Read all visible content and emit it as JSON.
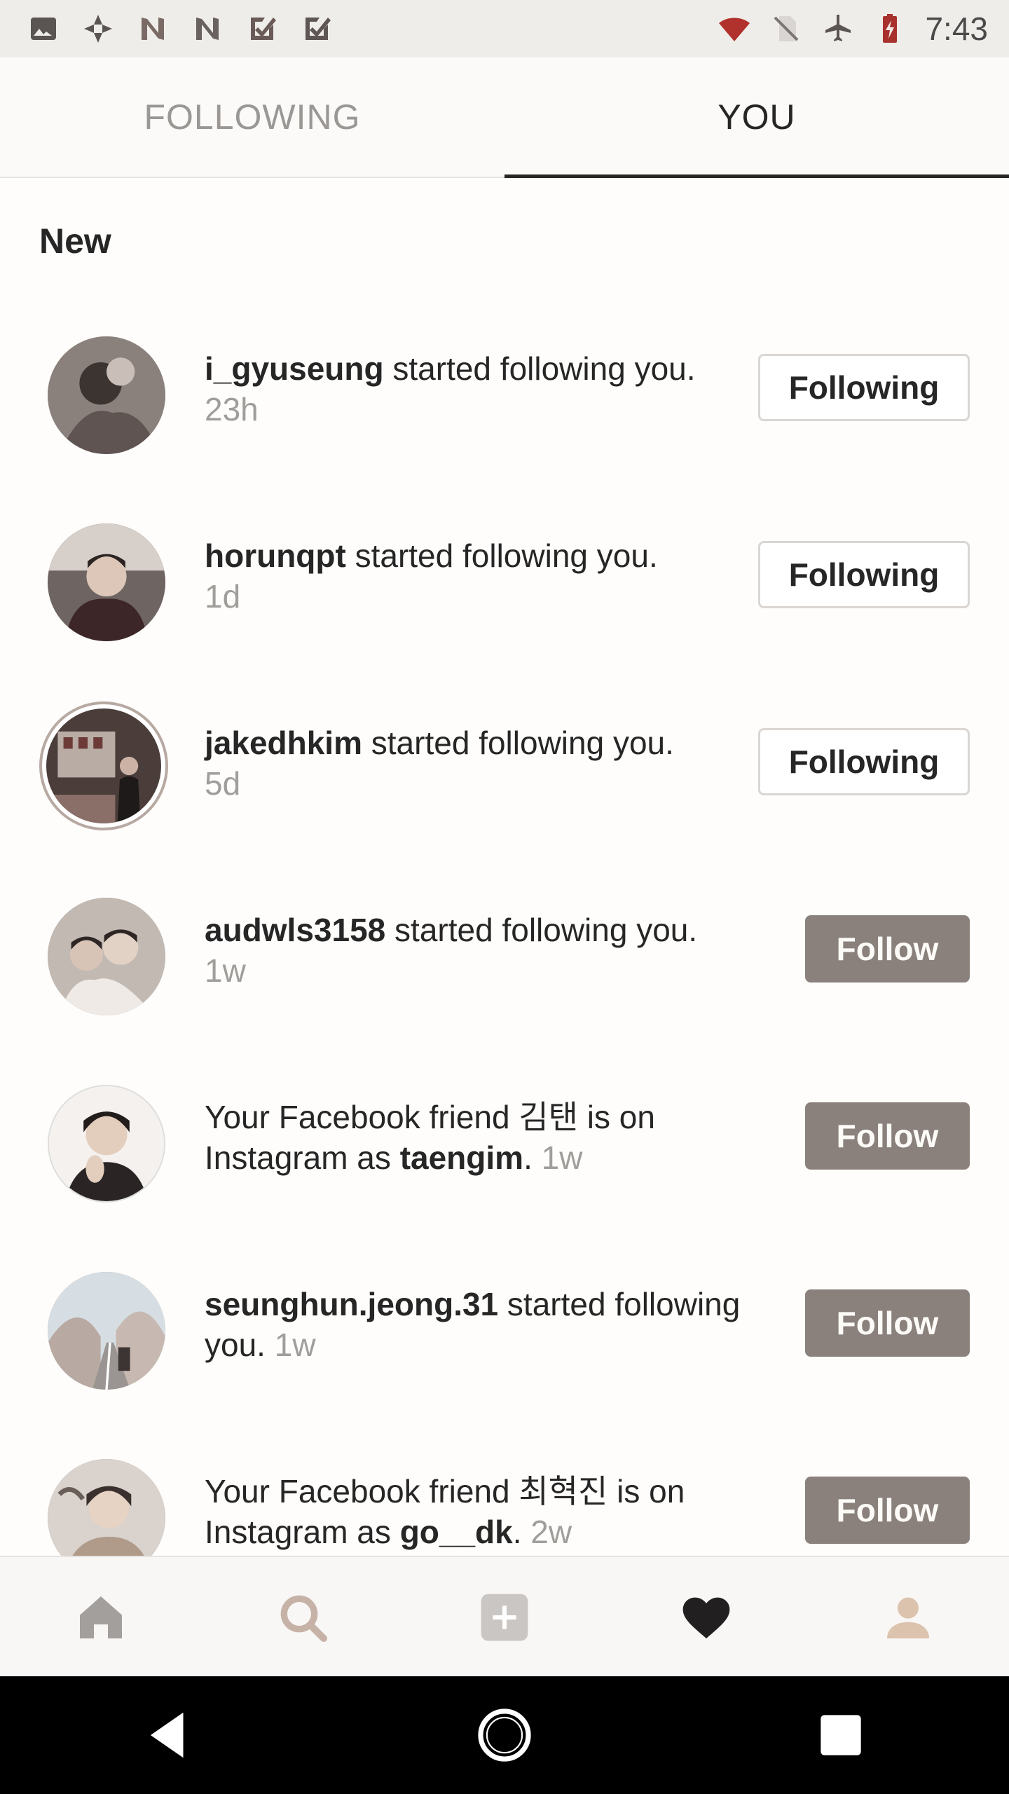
{
  "status_bar": {
    "time": "7:43",
    "left_icons": [
      "image-icon",
      "pinwheel-icon",
      "n-logo-icon",
      "n-logo-icon",
      "check-app-icon",
      "check-app-icon"
    ],
    "right_icons": [
      "wifi-icon",
      "no-sim-icon",
      "airplane-icon",
      "battery-charging-icon"
    ]
  },
  "tabs": {
    "following_label": "FOLLOWING",
    "you_label": "YOU",
    "active": "YOU"
  },
  "section": {
    "title": "New"
  },
  "notifications": [
    {
      "username": "i_gyuseung",
      "text": " started following you.",
      "time": "23h",
      "button": "Following"
    },
    {
      "username": "horunqpt",
      "text": " started following you.",
      "time": "1d",
      "button": "Following"
    },
    {
      "username": "jakedhkim",
      "text": " started following you.",
      "time": "5d",
      "button": "Following"
    },
    {
      "username": "audwls3158",
      "text": " started following you.",
      "time": "1w",
      "button": "Follow"
    },
    {
      "prefix": "Your Facebook friend 김탠 is on Instagram as ",
      "username": "taengim",
      "suffix": ". ",
      "time": "1w",
      "button": "Follow"
    },
    {
      "username": "seunghun.jeong.31",
      "text": " started following you. ",
      "time": "1w",
      "button": "Follow"
    },
    {
      "prefix": "Your Facebook friend 최혁진 is on Instagram as ",
      "username": "go__dk",
      "suffix": ". ",
      "time": "2w",
      "button": "Follow"
    }
  ],
  "bottom_nav": {
    "items": [
      "home-icon",
      "search-icon",
      "add-post-icon",
      "heart-icon",
      "profile-icon"
    ],
    "active": "heart-icon"
  },
  "system_nav": [
    "back-icon",
    "home-circle-icon",
    "recents-icon"
  ],
  "colors": {
    "follow_button": "#8a817c",
    "text_primary": "#262626",
    "text_secondary": "#a09d9a",
    "background": "#fefdfb"
  }
}
